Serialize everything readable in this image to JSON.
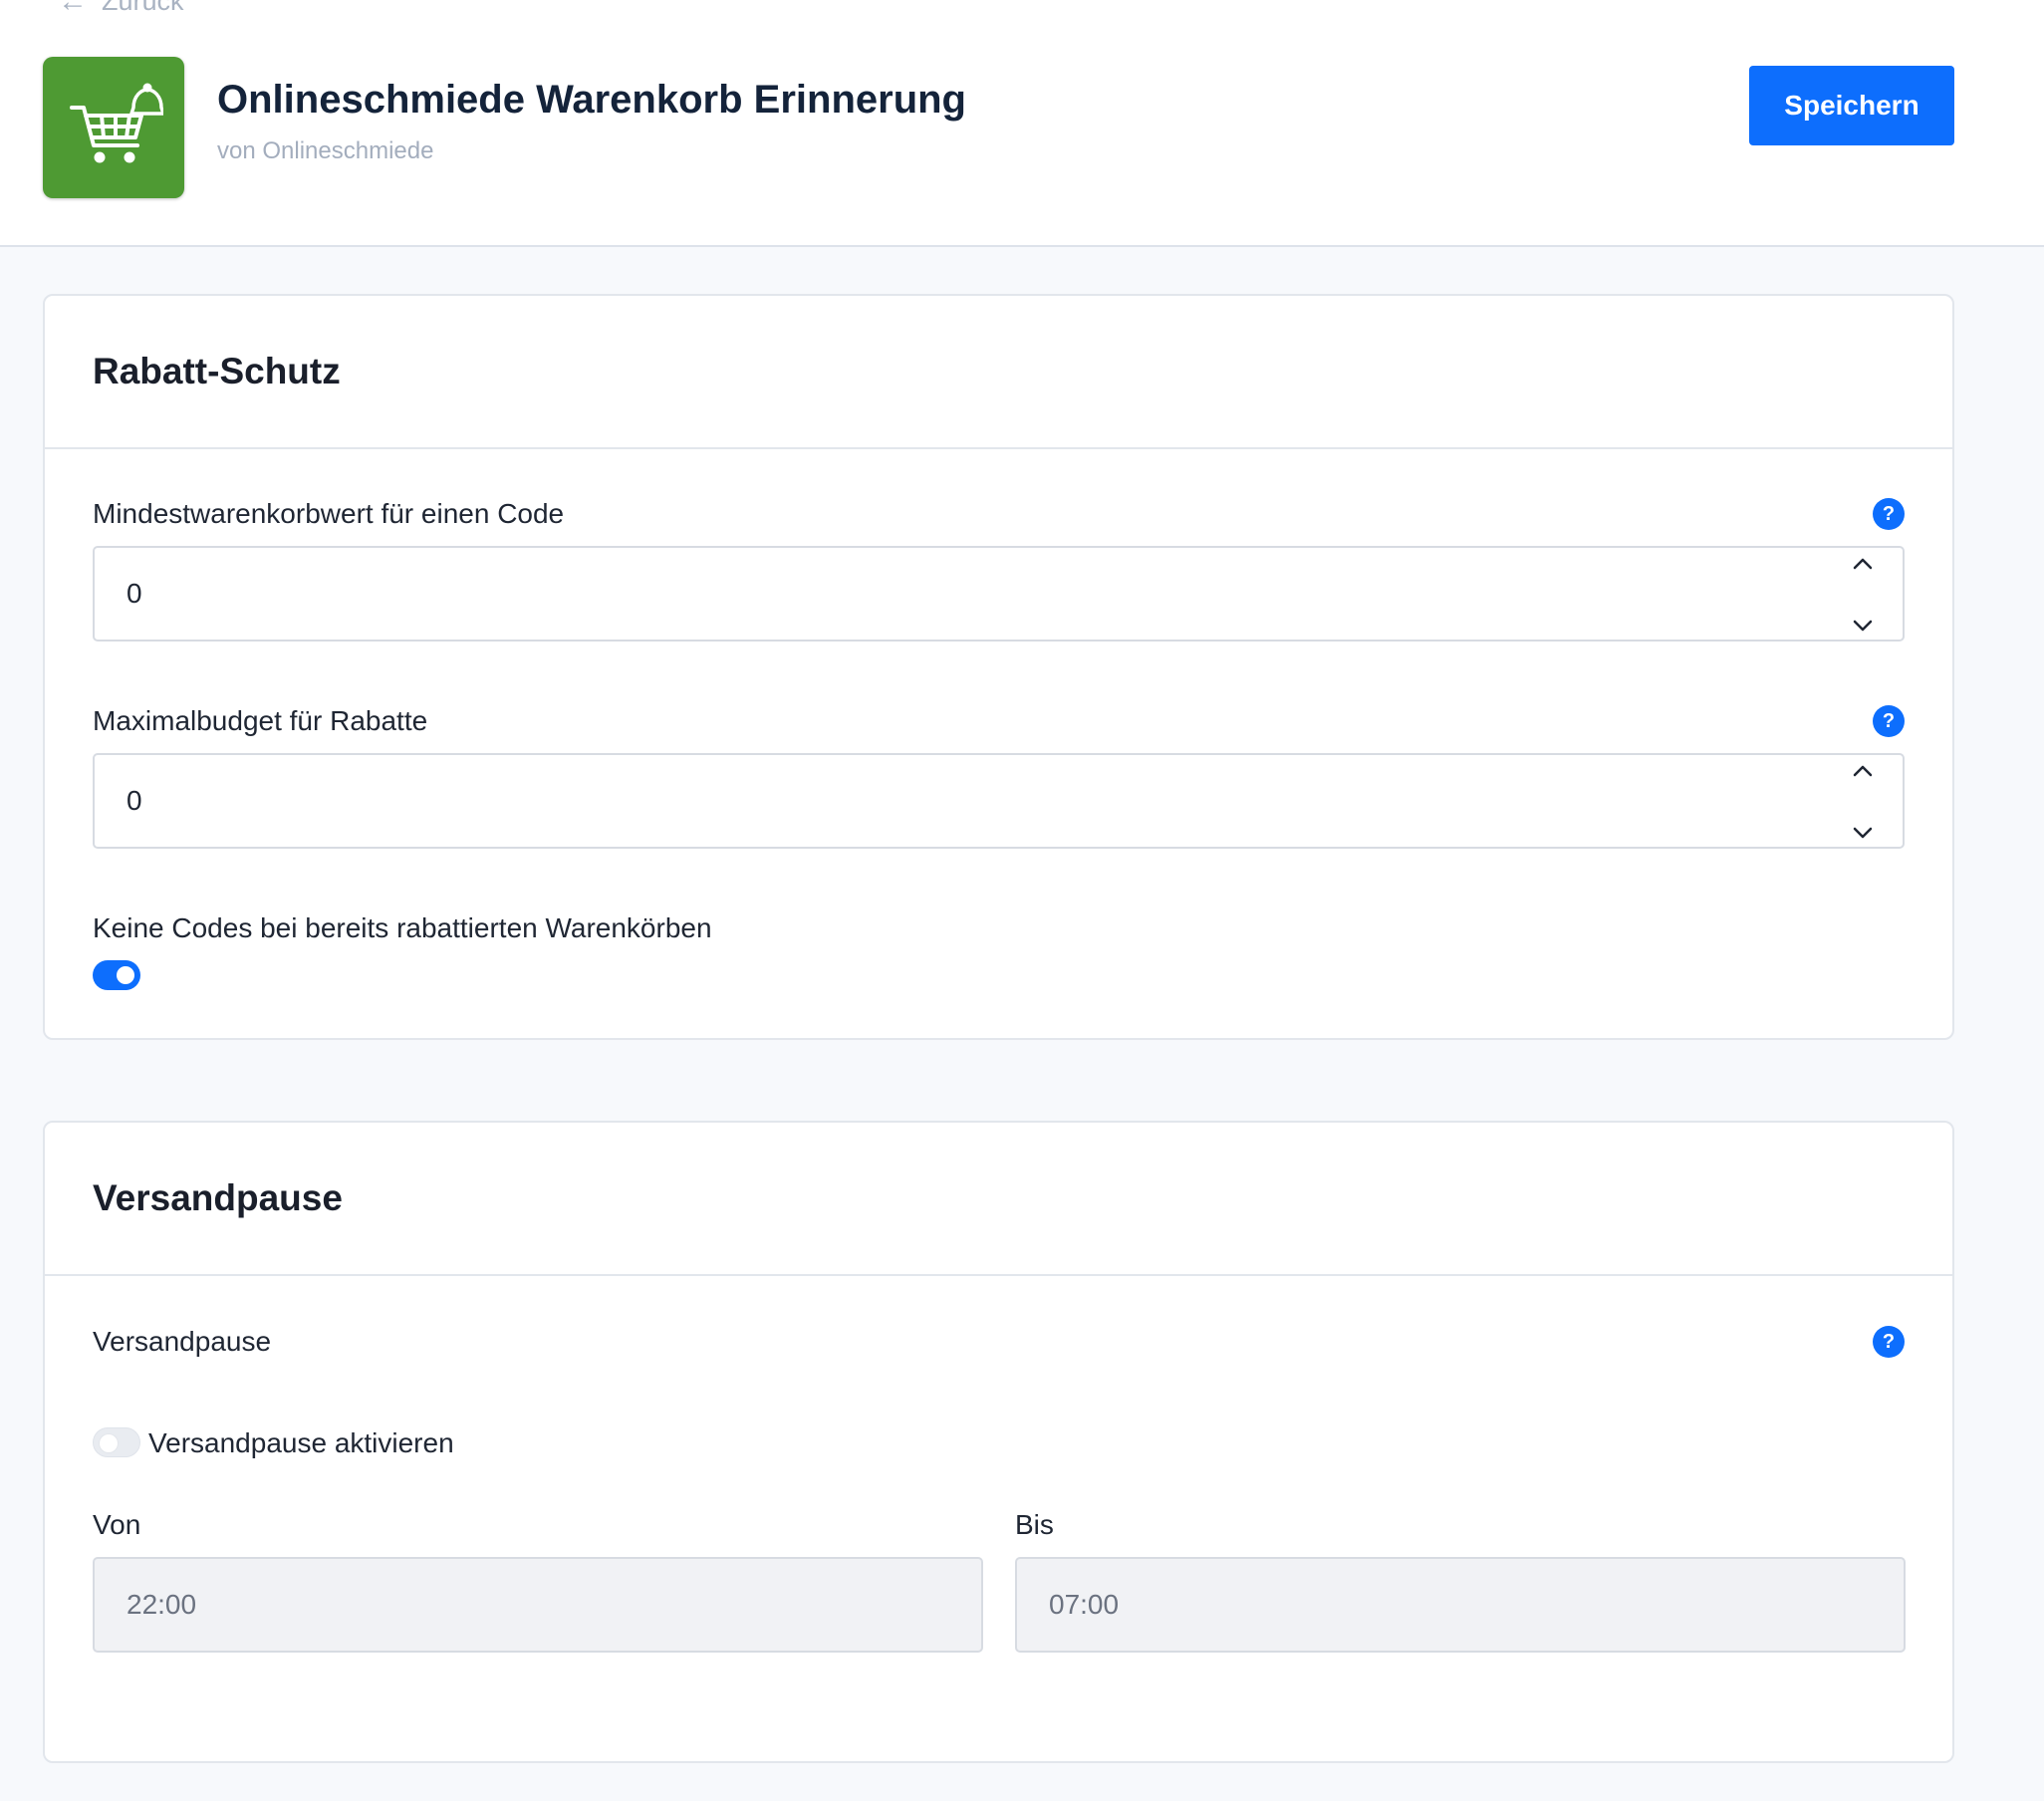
{
  "header": {
    "back_label": "Zurück",
    "app_title": "Onlineschmiede Warenkorb Erinnerung",
    "vendor": "von Onlineschmiede",
    "save_label": "Speichern",
    "app_icon": "shopping-cart-bell-icon",
    "accent_color": "#0d6efd",
    "icon_bg_color": "#4e9a33"
  },
  "rabatt": {
    "title": "Rabatt-Schutz",
    "min_label": "Mindestwarenkorbwert für einen Code",
    "min_value": "0",
    "budget_label": "Maximalbudget für Rabatte",
    "budget_value": "0",
    "no_codes_label": "Keine Codes bei bereits rabattierten Warenkörben",
    "no_codes_enabled": true,
    "help_glyph": "?"
  },
  "versand": {
    "title": "Versandpause",
    "section_label": "Versandpause",
    "activate_label": "Versandpause aktivieren",
    "activate_enabled": false,
    "from_label": "Von",
    "from_value": "22:00",
    "to_label": "Bis",
    "to_value": "07:00",
    "help_glyph": "?"
  }
}
